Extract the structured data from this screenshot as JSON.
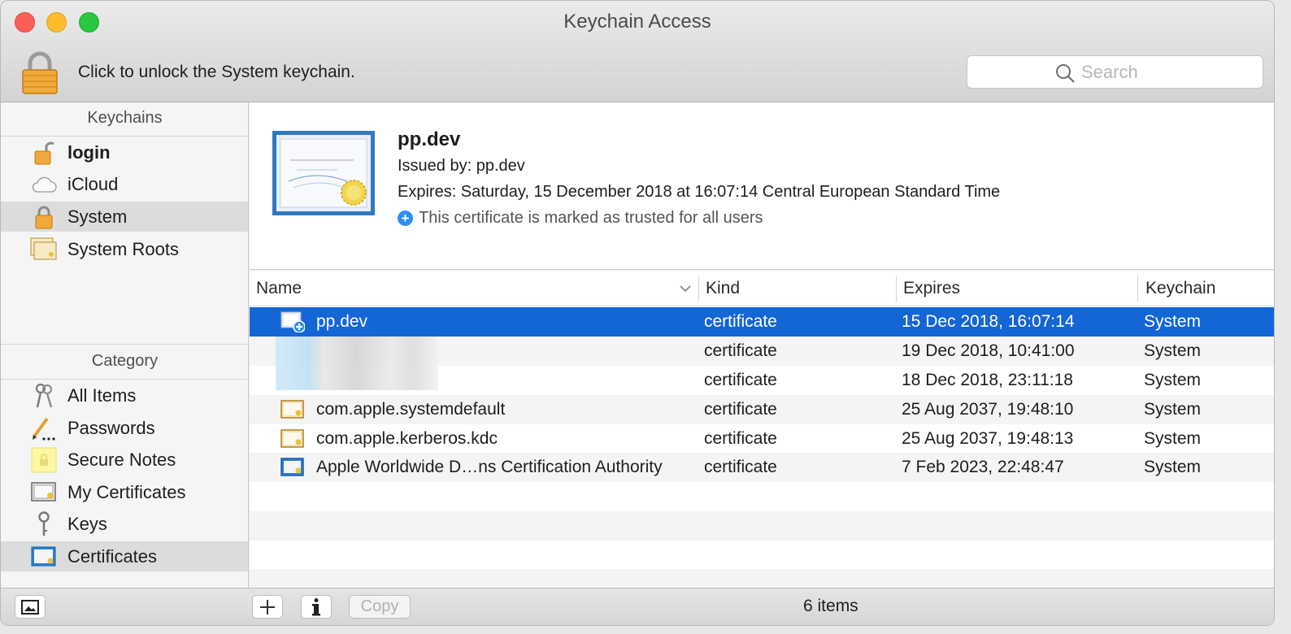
{
  "window": {
    "title": "Keychain Access"
  },
  "toolbar": {
    "unlock_text": "Click to unlock the System keychain.",
    "search_placeholder": "Search"
  },
  "sidebar": {
    "keychains_header": "Keychains",
    "keychains": [
      {
        "label": "login",
        "icon": "unlocked-padlock-icon",
        "bold": true
      },
      {
        "label": "iCloud",
        "icon": "cloud-icon"
      },
      {
        "label": "System",
        "icon": "padlock-icon",
        "selected": true
      },
      {
        "label": "System Roots",
        "icon": "certificates-stack-icon"
      }
    ],
    "category_header": "Category",
    "categories": [
      {
        "label": "All Items",
        "icon": "keys-icon"
      },
      {
        "label": "Passwords",
        "icon": "pencil-icon"
      },
      {
        "label": "Secure Notes",
        "icon": "note-icon"
      },
      {
        "label": "My Certificates",
        "icon": "my-certificate-icon"
      },
      {
        "label": "Keys",
        "icon": "key-icon"
      },
      {
        "label": "Certificates",
        "icon": "certificate-icon",
        "selected": true
      }
    ]
  },
  "detail": {
    "name": "pp.dev",
    "issued_by": "Issued by: pp.dev",
    "expires": "Expires: Saturday, 15 December 2018 at 16:07:14 Central European Standard Time",
    "trust": "This certificate is marked as trusted for all users",
    "icon": "certificate-standard-icon"
  },
  "table": {
    "columns": [
      "Name",
      "Kind",
      "Expires",
      "Keychain"
    ],
    "sorted_by": "Name",
    "rows": [
      {
        "name": "pp.dev",
        "kind": "certificate",
        "expires": "15 Dec 2018, 16:07:14",
        "keychain": "System",
        "icon": "trusted-certificate-icon",
        "selected": true
      },
      {
        "name": "",
        "kind": "certificate",
        "expires": "19 Dec 2018, 10:41:00",
        "keychain": "System",
        "redacted": true
      },
      {
        "name": "",
        "kind": "certificate",
        "expires": "18 Dec 2018, 23:11:18",
        "keychain": "System",
        "redacted": true
      },
      {
        "name": "com.apple.systemdefault",
        "kind": "certificate",
        "expires": "25 Aug 2037, 19:48:10",
        "keychain": "System",
        "icon": "certificate-icon"
      },
      {
        "name": "com.apple.kerberos.kdc",
        "kind": "certificate",
        "expires": "25 Aug 2037, 19:48:13",
        "keychain": "System",
        "icon": "certificate-icon"
      },
      {
        "name": "Apple Worldwide D…ns Certification Authority",
        "kind": "certificate",
        "expires": "7 Feb 2023, 22:48:47",
        "keychain": "System",
        "icon": "root-certificate-icon"
      }
    ]
  },
  "bottombar": {
    "copy_label": "Copy",
    "item_count": "6 items"
  },
  "colors": {
    "selection": "#1466d6",
    "accent": "#2e8ff0"
  }
}
